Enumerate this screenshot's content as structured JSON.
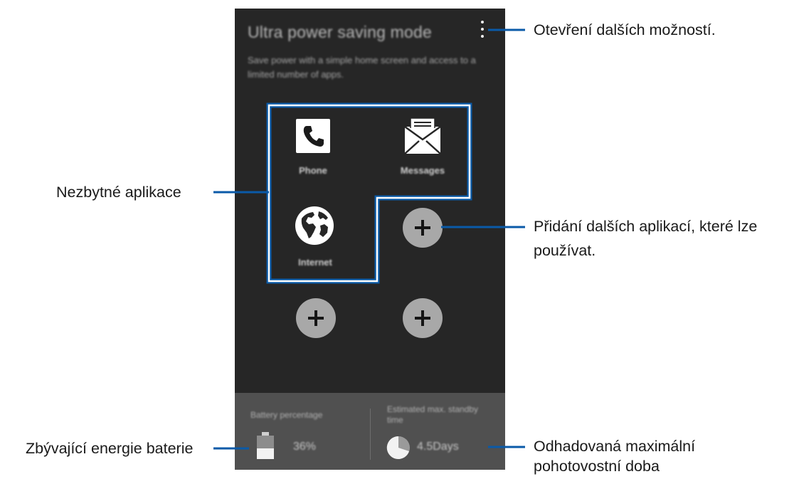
{
  "screen": {
    "title": "Ultra power saving mode",
    "description": "Save power with a simple home screen and access to a limited number of apps.",
    "more_options_icon": "more-vertical-icon"
  },
  "apps": [
    {
      "label": "Phone",
      "icon": "phone-icon"
    },
    {
      "label": "Messages",
      "icon": "envelope-icon"
    },
    {
      "label": "Internet",
      "icon": "globe-icon"
    }
  ],
  "add_buttons": {
    "icon": "plus-icon",
    "count": 3
  },
  "status": {
    "battery_label": "Battery percentage",
    "battery_value": "36%",
    "battery_level": 0.36,
    "standby_label": "Estimated max. standby time",
    "standby_value": "4.5Days"
  },
  "callouts": {
    "more_options": "Otevření dalších možností.",
    "essential_apps": "Nezbytné aplikace",
    "add_apps_line1": "Přidání dalších aplikací, které lze",
    "add_apps_line2": "používat.",
    "battery": "Zbývající energie baterie",
    "standby_line1": "Odhadovaná maximální",
    "standby_line2": "pohotovostní doba"
  },
  "colors": {
    "screen_background": "#262626",
    "status_panel": "#505050",
    "callout_line": "#0a5aa8",
    "add_button": "#a8a8a8"
  }
}
